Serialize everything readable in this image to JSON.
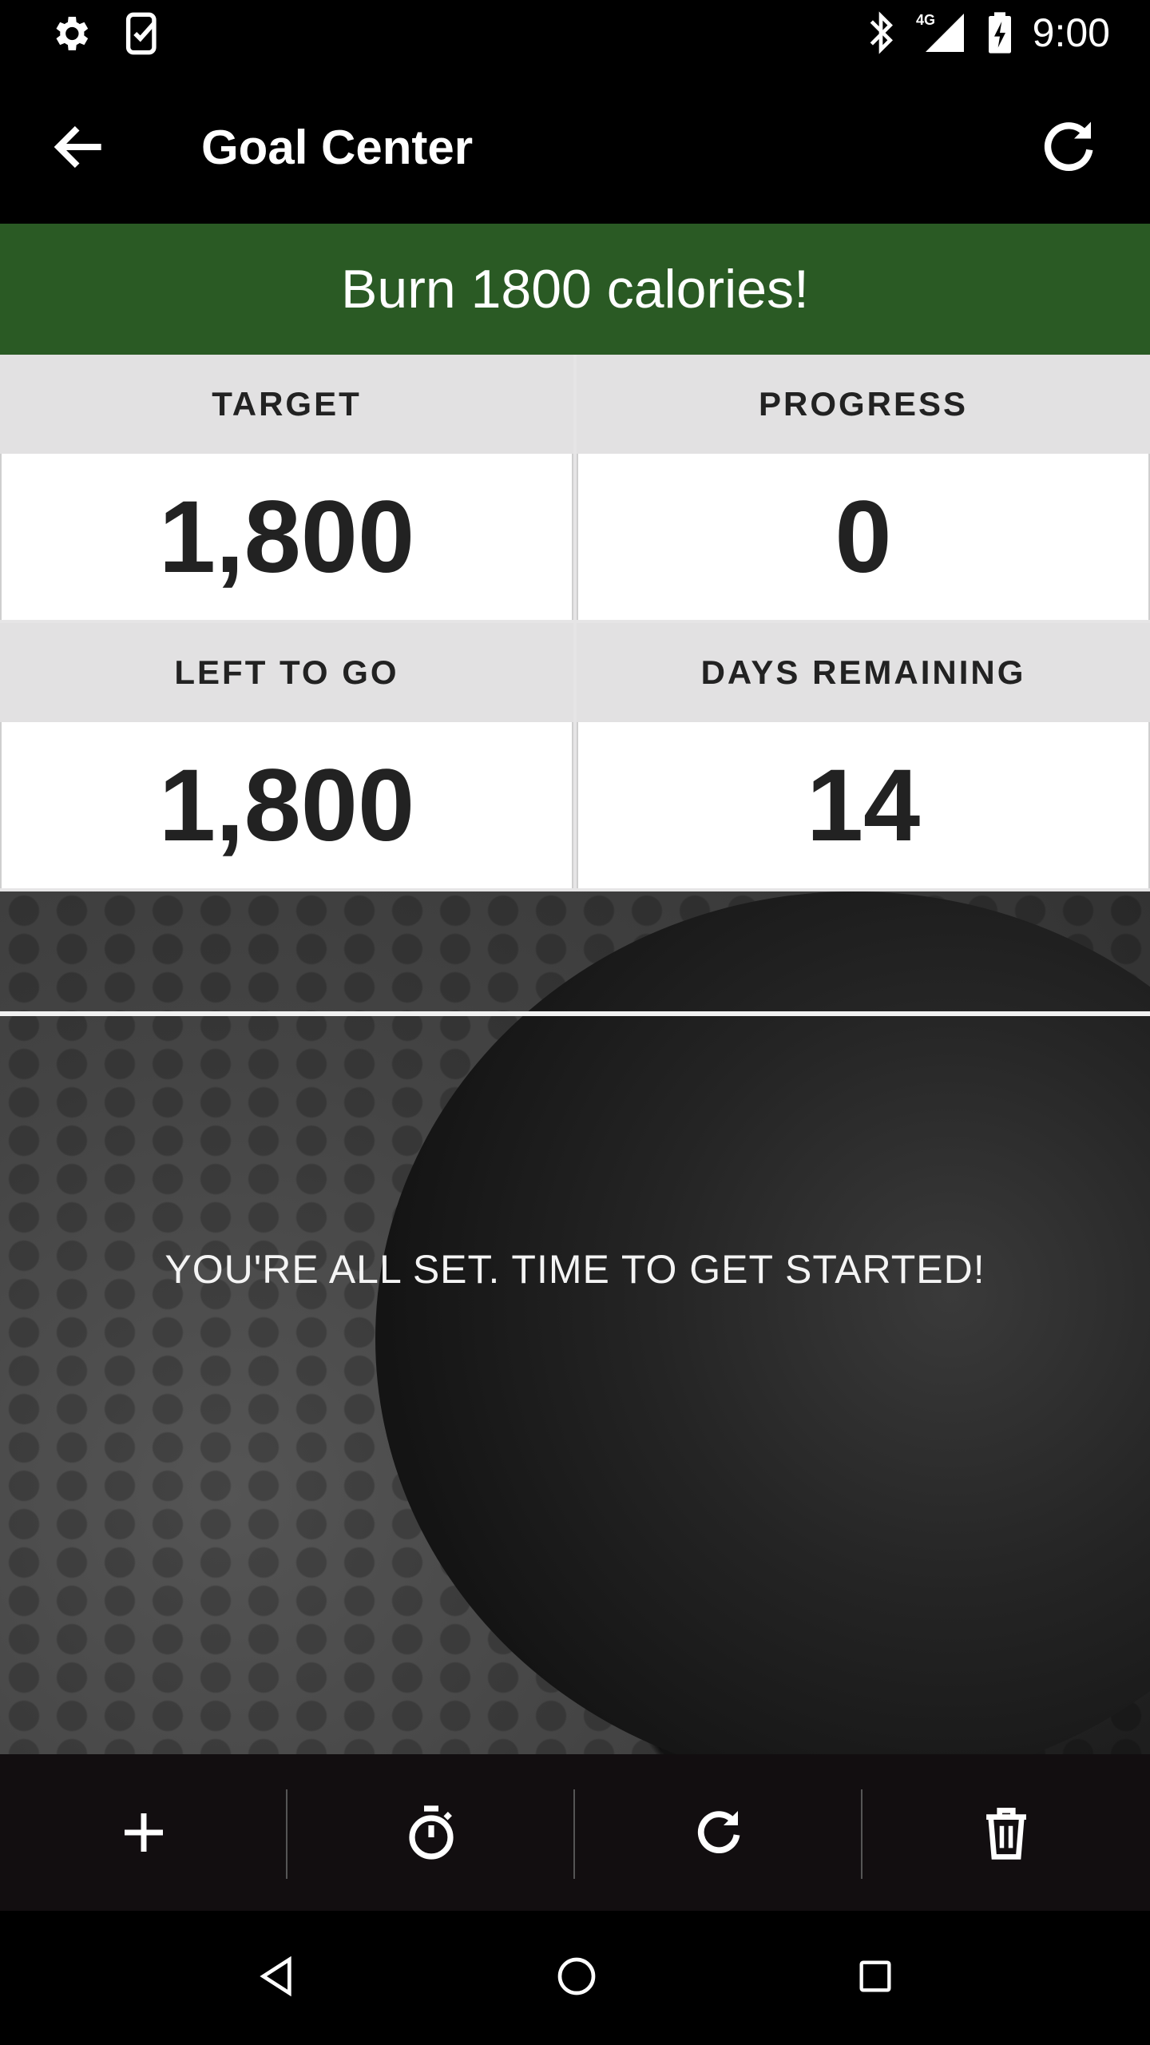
{
  "status_bar": {
    "time": "9:00",
    "network": "4G",
    "left_icons": [
      "settings-icon",
      "clipboard-check-icon"
    ],
    "right_icons": [
      "bluetooth-icon",
      "signal-icon",
      "battery-charging-icon"
    ]
  },
  "app_bar": {
    "title": "Goal Center",
    "back_icon": "arrow-back-icon",
    "refresh_icon": "refresh-icon"
  },
  "goal": {
    "title": "Burn 1800 calories!",
    "banner_color": "#2a5a24"
  },
  "stats": [
    {
      "label": "TARGET",
      "value": "1,800"
    },
    {
      "label": "PROGRESS",
      "value": "0"
    },
    {
      "label": "LEFT TO GO",
      "value": "1,800"
    },
    {
      "label": "DAYS REMAINING",
      "value": "14"
    }
  ],
  "message": "YOU'RE ALL SET. TIME TO GET STARTED!",
  "toolbar": {
    "buttons": [
      "add-icon",
      "timer-icon",
      "refresh-icon",
      "trash-icon"
    ]
  },
  "nav_bar": {
    "buttons": [
      "back-triangle-icon",
      "home-circle-icon",
      "recents-square-icon"
    ]
  }
}
